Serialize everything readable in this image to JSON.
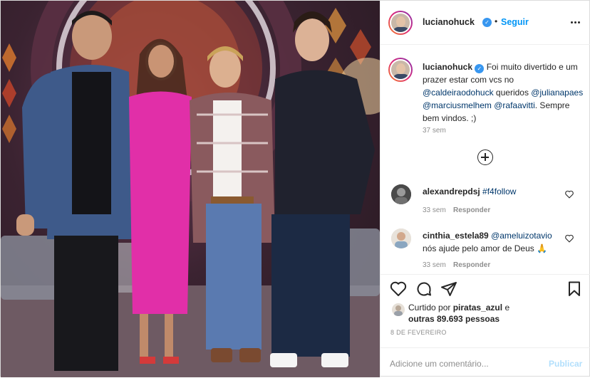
{
  "header": {
    "username": "lucianohuck",
    "separator": "•",
    "follow_label": "Seguir",
    "more_icon": "more-horizontal-icon",
    "verified_icon": "verified-badge-icon"
  },
  "caption": {
    "username": "lucianohuck",
    "text_1": "Foi muito divertido e um prazer estar com vcs no",
    "mention_1": "@caldeiraodohuck",
    "text_2": "queridos",
    "mention_2": "@julianapaes",
    "mention_3": "@marciusmelhem",
    "mention_4": "@rafaavitti",
    "text_3": ". Sempre bem vindos. ;)",
    "time": "37 sem"
  },
  "load_more_icon": "plus-circle-icon",
  "comments": [
    {
      "username": "alexandrepdsj",
      "mention": "#f4follow",
      "text": "",
      "time": "33 sem",
      "reply_label": "Responder"
    },
    {
      "username": "cinthia_estela89",
      "mention": "@ameluizotavio",
      "text": "nós ajude pelo amor de Deus 🙏",
      "time": "33 sem",
      "reply_label": "Responder"
    }
  ],
  "actions": {
    "like_icon": "heart-icon",
    "comment_icon": "comment-icon",
    "share_icon": "paper-plane-icon",
    "save_icon": "bookmark-icon"
  },
  "likes": {
    "prefix": "Curtido por",
    "user": "piratas_azul",
    "conjunction": "e",
    "others": "outras 89.693 pessoas"
  },
  "date": "8 DE FEVEREIRO",
  "comment_box": {
    "placeholder": "Adicione um comentário...",
    "publish_label": "Publicar"
  },
  "colors": {
    "link_blue": "#0095f6",
    "mention_blue": "#00376b",
    "muted_gray": "#8e8e8e",
    "publish_disabled": "#b2dffc"
  }
}
